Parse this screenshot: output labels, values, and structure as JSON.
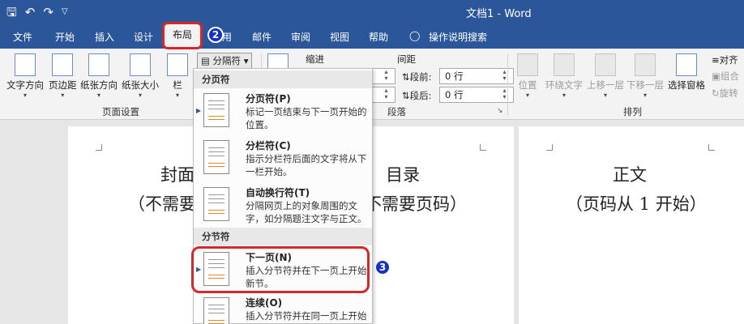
{
  "titlebar": {
    "save_icon": "save-icon",
    "undo_icon": "undo-icon",
    "redo_icon": "redo-icon",
    "customize_icon": "customize-qat-icon",
    "doc_title": "文档1 - Word"
  },
  "tabs": {
    "file": "文件",
    "home": "开始",
    "insert": "插入",
    "design": "设计",
    "layout": "布局",
    "references_partial": "用",
    "mailings": "邮件",
    "review": "审阅",
    "view": "视图",
    "help": "帮助",
    "tell_me": "操作说明搜索"
  },
  "badges": {
    "step2": "2",
    "step3": "3"
  },
  "ribbon": {
    "text_direction": "文字方向",
    "margins": "页边距",
    "orientation": "纸张方向",
    "size": "纸张大小",
    "columns": "栏",
    "breaks": "分隔符",
    "breaks_caret": "▾",
    "page_setup_group": "页面设置",
    "indent": "缩进",
    "spacing": "间距",
    "before_label": "段前:",
    "after_label": "段后:",
    "before_value": "0 行",
    "after_value": "0 行",
    "paragraph_group": "段落",
    "position": "位置",
    "wrap_text": "环绕文字",
    "bring_forward": "上移一层",
    "send_backward": "下移一层",
    "selection_pane": "选择窗格",
    "align": "对齐",
    "group": "组合",
    "rotate": "旋转",
    "arrange_group": "排列"
  },
  "pages": {
    "cover_line1": "封面",
    "cover_line2": "（不需要页",
    "toc_line1": "目录",
    "toc_line2": "不需要页码）",
    "body_line1": "正文",
    "body_line2": "（页码从 1 开始）"
  },
  "dropdown": {
    "page_breaks_header": "分页符",
    "section_breaks_header": "分节符",
    "items": [
      {
        "title": "分页符(P)",
        "desc": "标记一页结束与下一页开始的位置。"
      },
      {
        "title": "分栏符(C)",
        "desc": "指示分栏符后面的文字将从下一栏开始。"
      },
      {
        "title": "自动换行符(T)",
        "desc": "分隔网页上的对象周围的文字，如分隔题注文字与正文。"
      },
      {
        "title": "下一页(N)",
        "desc": "插入分节符并在下一页上开始新节。"
      },
      {
        "title": "连续(O)",
        "desc": "插入分节符并在同一页上开始"
      }
    ]
  }
}
